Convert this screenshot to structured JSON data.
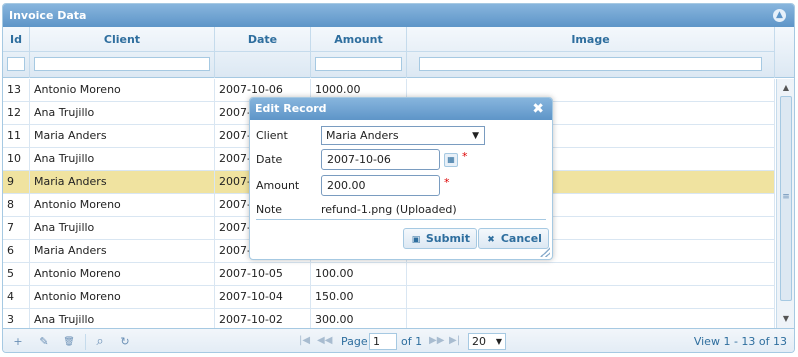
{
  "grid": {
    "caption": "Invoice Data",
    "collapse_glyph": "▲",
    "columns": [
      "Id",
      "Client",
      "Date",
      "Amount",
      "Image"
    ],
    "rows": [
      {
        "id": "13",
        "client": "Antonio Moreno",
        "date": "2007-10-06",
        "amount": "1000.00"
      },
      {
        "id": "12",
        "client": "Ana Trujillo",
        "date": "2007-10-06",
        "amount": ""
      },
      {
        "id": "11",
        "client": "Maria Anders",
        "date": "2007-10-06",
        "amount": ""
      },
      {
        "id": "10",
        "client": "Ana Trujillo",
        "date": "2007-10-06",
        "amount": ""
      },
      {
        "id": "9",
        "client": "Maria Anders",
        "date": "2007-10-06",
        "amount": ""
      },
      {
        "id": "8",
        "client": "Antonio Moreno",
        "date": "2007-10-06",
        "amount": ""
      },
      {
        "id": "7",
        "client": "Ana Trujillo",
        "date": "2007-10-06",
        "amount": ""
      },
      {
        "id": "6",
        "client": "Maria Anders",
        "date": "2007-10-06",
        "amount": ""
      },
      {
        "id": "5",
        "client": "Antonio Moreno",
        "date": "2007-10-05",
        "amount": "100.00"
      },
      {
        "id": "4",
        "client": "Antonio Moreno",
        "date": "2007-10-04",
        "amount": "150.00"
      },
      {
        "id": "3",
        "client": "Ana Trujillo",
        "date": "2007-10-02",
        "amount": "300.00"
      }
    ],
    "selected_row_id": "9"
  },
  "pager": {
    "icons": {
      "add": "+",
      "edit": "✎",
      "delete": "🗑",
      "search": "⌕",
      "refresh": "↻"
    },
    "nav": {
      "first": "|◀",
      "prev": "◀◀",
      "next": "▶▶",
      "last": "▶|"
    },
    "page_label": "Page",
    "page_value": "1",
    "of_label": "of 1",
    "page_size": "20",
    "view_text": "View 1 - 13 of 13"
  },
  "dialog": {
    "title": "Edit Record",
    "close_glyph": "✖",
    "fields": {
      "client_label": "Client",
      "client_value": "Maria Anders",
      "date_label": "Date",
      "date_value": "2007-10-06",
      "amount_label": "Amount",
      "amount_value": "200.00",
      "note_label": "Note",
      "note_value": "refund-1.png (Uploaded)"
    },
    "required_mark": "*",
    "submit_label": "Submit",
    "cancel_label": "Cancel"
  },
  "colors": {
    "accent": "#5e95c8",
    "selected_row": "#f0e3a0",
    "header_text": "#2e6e9e"
  }
}
